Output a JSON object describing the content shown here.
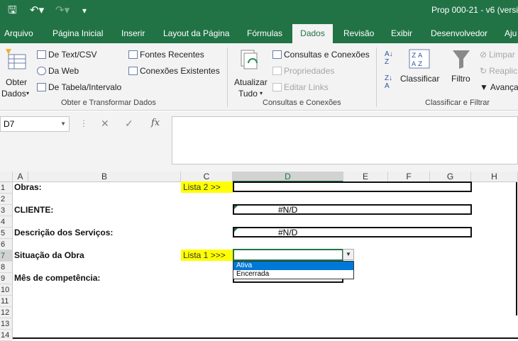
{
  "window": {
    "title": "Prop 000-21 - v6 (versi"
  },
  "quick_access": {
    "save_icon": "save-icon",
    "undo_icon": "undo-icon",
    "redo_icon": "redo-icon",
    "customize_icon": "customize-qat-icon"
  },
  "tabs": [
    "Arquivo",
    "Página Inicial",
    "Inserir",
    "Layout da Página",
    "Fórmulas",
    "Dados",
    "Revisão",
    "Exibir",
    "Desenvolvedor",
    "Aju"
  ],
  "active_tab": "Dados",
  "ribbon": {
    "get_data": {
      "line1": "Obter",
      "line2": "Dados"
    },
    "from_text": "De Text/CSV",
    "from_web": "Da Web",
    "from_table": "De Tabela/Intervalo",
    "recent_sources": "Fontes Recentes",
    "existing_connections": "Conexões Existentes",
    "group1_label": "Obter e Transformar Dados",
    "refresh_all": {
      "line1": "Atualizar",
      "line2": "Tudo"
    },
    "queries_connections": "Consultas e Conexões",
    "properties": "Propriedades",
    "edit_links": "Editar Links",
    "group2_label": "Consultas e Conexões",
    "sort": "Classificar",
    "filter": "Filtro",
    "clear": "Limpar",
    "reapply": "Reaplic",
    "advanced": "Avança",
    "group3_label": "Classificar e Filtrar"
  },
  "formula_bar": {
    "name_box": "D7",
    "cancel": "✕",
    "enter": "✓",
    "fx": "fx",
    "value": ""
  },
  "columns": [
    "A",
    "B",
    "C",
    "D",
    "E",
    "F",
    "G",
    "H"
  ],
  "rows": [
    "1",
    "2",
    "3",
    "4",
    "5",
    "6",
    "7",
    "8",
    "9",
    "10",
    "11",
    "12",
    "13",
    "14"
  ],
  "cells": {
    "obras": "Obras:",
    "lista2": "Lista 2 >>",
    "cliente": "CLIENTE:",
    "cliente_val": "#N/D",
    "descricao": "Descrição dos Serviços:",
    "descricao_val": "#N/D",
    "situacao": "Situação da Obra",
    "lista1": "Lista 1 >>>",
    "mes": "Mês de competência:"
  },
  "dropdown": {
    "options": [
      "Ativa",
      "Encerrada"
    ],
    "highlighted": "Ativa"
  },
  "colors": {
    "excel_green": "#217346",
    "highlight_yellow": "#ffff00",
    "selection_blue": "#0078d7"
  }
}
